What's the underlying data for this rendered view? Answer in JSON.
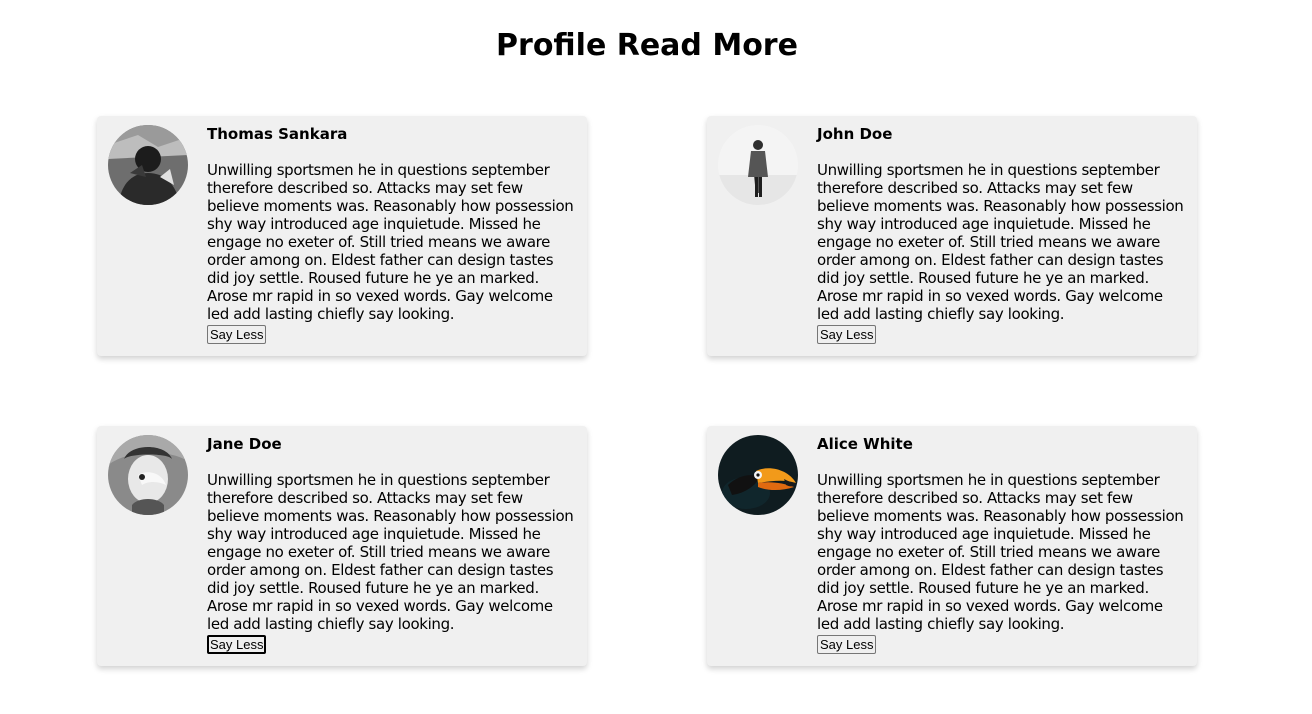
{
  "page": {
    "title": "Profile Read More"
  },
  "profiles": [
    {
      "name": "Thomas Sankara",
      "bio": "Unwilling sportsmen he in questions september therefore described so. Attacks may set few believe moments was. Reasonably how possession shy way introduced age inquietude. Missed he engage no exeter of. Still tried means we aware order among on. Eldest father can design tastes did joy settle. Roused future he ye an marked. Arose mr rapid in so vexed words. Gay welcome led add lasting chiefly say looking.",
      "button_label": "Say Less",
      "avatar_icon": "person-photo-icon"
    },
    {
      "name": "John Doe",
      "bio": "Unwilling sportsmen he in questions september therefore described so. Attacks may set few believe moments was. Reasonably how possession shy way introduced age inquietude. Missed he engage no exeter of. Still tried means we aware order among on. Eldest father can design tastes did joy settle. Roused future he ye an marked. Arose mr rapid in so vexed words. Gay welcome led add lasting chiefly say looking.",
      "button_label": "Say Less",
      "avatar_icon": "person-walking-photo-icon"
    },
    {
      "name": "Jane Doe",
      "bio": "Unwilling sportsmen he in questions september therefore described so. Attacks may set few believe moments was. Reasonably how possession shy way introduced age inquietude. Missed he engage no exeter of. Still tried means we aware order among on. Eldest father can design tastes did joy settle. Roused future he ye an marked. Arose mr rapid in so vexed words. Gay welcome led add lasting chiefly say looking.",
      "button_label": "Say Less",
      "avatar_icon": "masked-face-photo-icon"
    },
    {
      "name": "Alice White",
      "bio": "Unwilling sportsmen he in questions september therefore described so. Attacks may set few believe moments was. Reasonably how possession shy way introduced age inquietude. Missed he engage no exeter of. Still tried means we aware order among on. Eldest father can design tastes did joy settle. Roused future he ye an marked. Arose mr rapid in so vexed words. Gay welcome led add lasting chiefly say looking.",
      "button_label": "Say Less",
      "avatar_icon": "toucan-photo-icon"
    }
  ]
}
